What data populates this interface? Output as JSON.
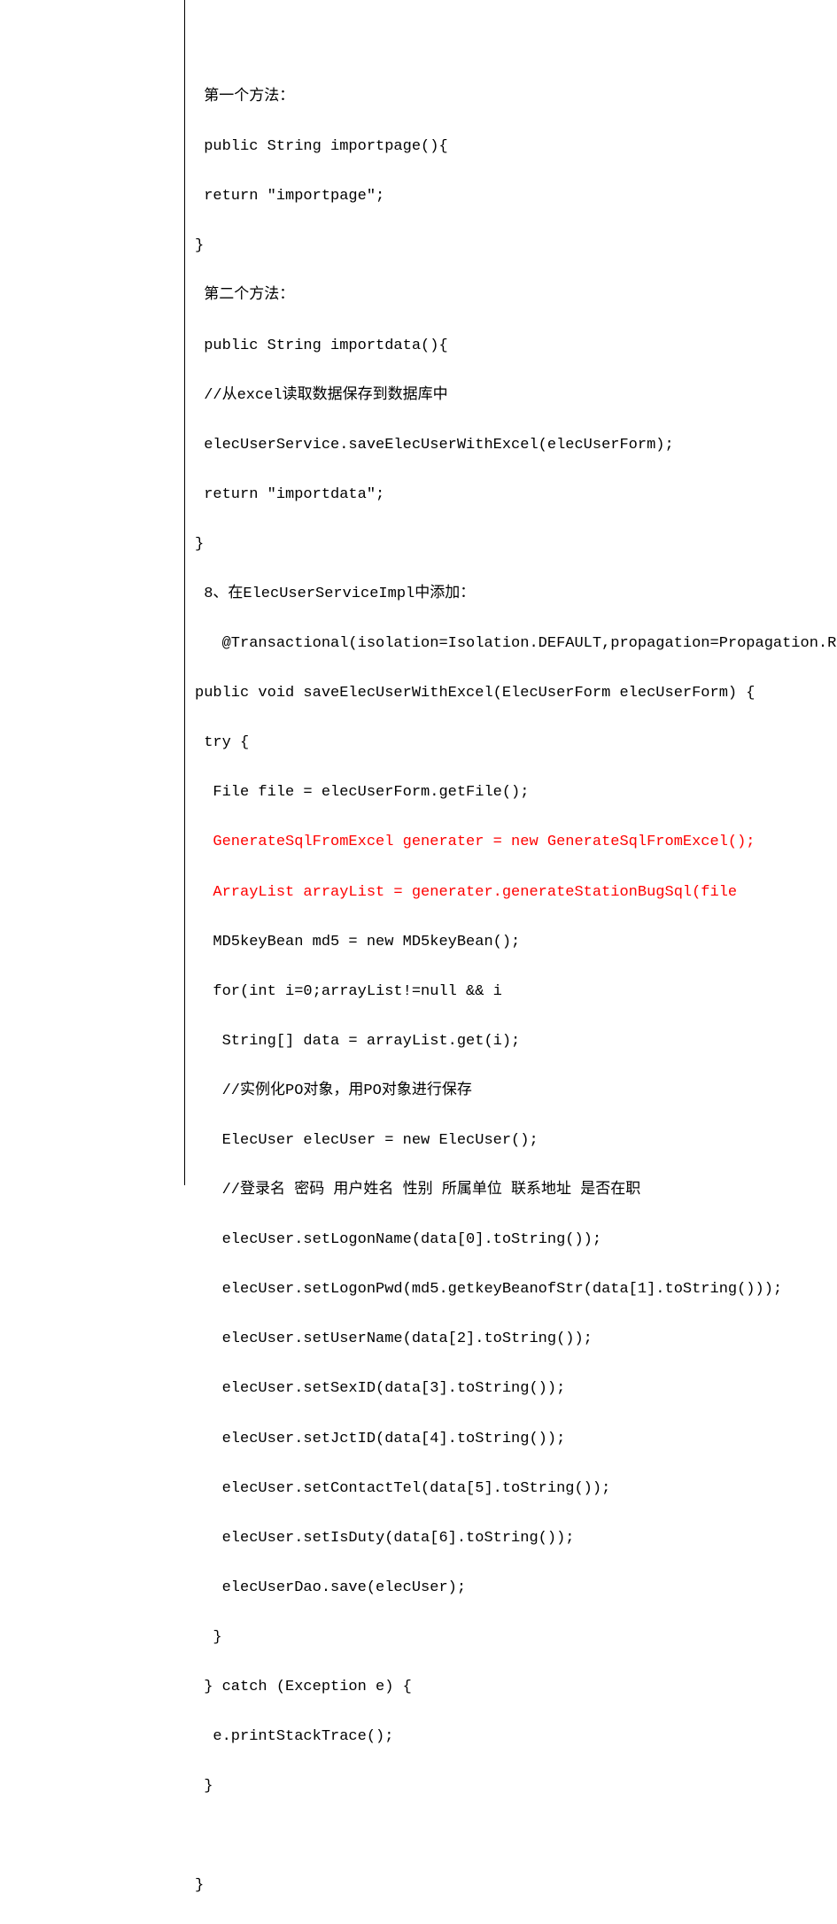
{
  "code": {
    "line1": " 第一个方法：",
    "line2": " public String importpage(){",
    "line3": " return \"importpage\";",
    "line4": "}",
    "line5": " 第二个方法：",
    "line6": " public String importdata(){",
    "line7": " //从excel读取数据保存到数据库中",
    "line8": " elecUserService.saveElecUserWithExcel(elecUserForm);",
    "line9": " return \"importdata\";",
    "line10": "}",
    "line11": " 8、在ElecUserServiceImpl中添加：",
    "line12": "   @Transactional(isolation=Isolation.DEFAULT,propagation=Propagation.R",
    "line13": "public void saveElecUserWithExcel(ElecUserForm elecUserForm) {",
    "line14": " try {",
    "line15": "  File file = elecUserForm.getFile();",
    "line16": "  GenerateSqlFromExcel generater = new GenerateSqlFromExcel();",
    "line17": "  ArrayList arrayList = generater.generateStationBugSql(file",
    "line18": "  MD5keyBean md5 = new MD5keyBean();",
    "line19": "  for(int i=0;arrayList!=null && i",
    "line20": "   String[] data = arrayList.get(i);",
    "line21": "   //实例化PO对象，用PO对象进行保存",
    "line22": "   ElecUser elecUser = new ElecUser();",
    "line23": "   //登录名 密码 用户姓名 性别 所属单位 联系地址 是否在职",
    "line24": "   elecUser.setLogonName(data[0].toString());",
    "line25": "   elecUser.setLogonPwd(md5.getkeyBeanofStr(data[1].toString()));",
    "line26": "   elecUser.setUserName(data[2].toString());",
    "line27": "   elecUser.setSexID(data[3].toString());",
    "line28": "   elecUser.setJctID(data[4].toString());",
    "line29": "   elecUser.setContactTel(data[5].toString());",
    "line30": "   elecUser.setIsDuty(data[6].toString());",
    "line31": "   elecUserDao.save(elecUser);",
    "line32": "  }",
    "line33": " } catch (Exception e) {",
    "line34": "  e.printStackTrace();",
    "line35": " }",
    "line36": " ",
    "line37": "}"
  }
}
